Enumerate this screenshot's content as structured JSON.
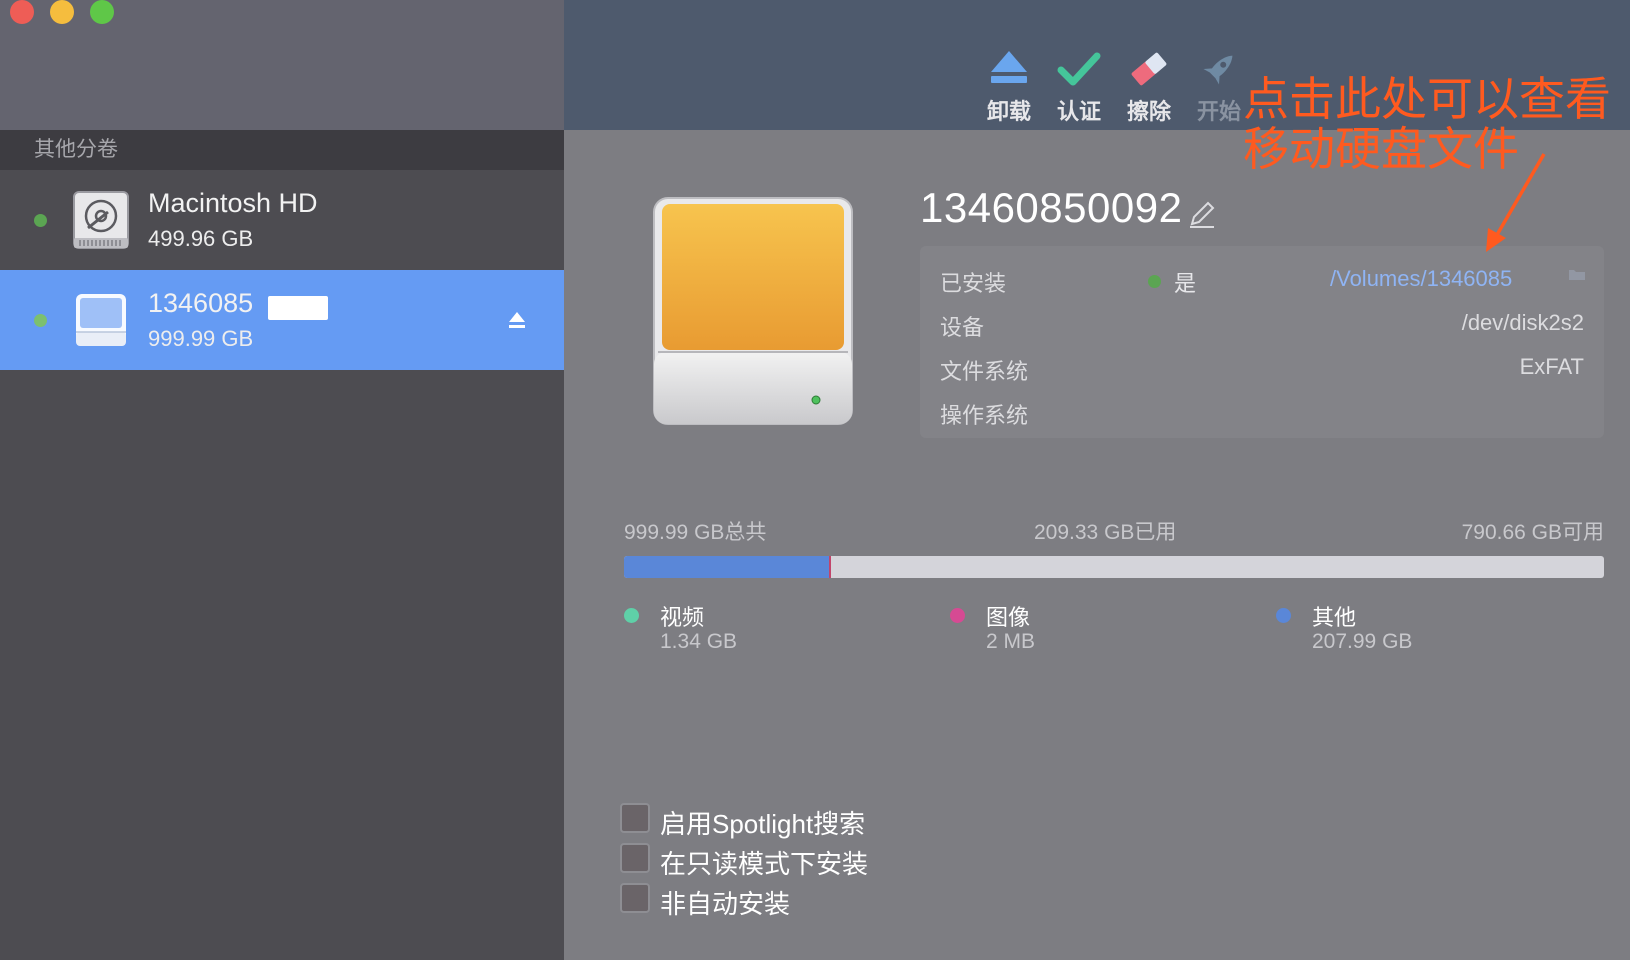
{
  "window": {
    "controls": [
      "close",
      "minimize",
      "maximize"
    ]
  },
  "sidebar": {
    "section_title": "其他分卷",
    "volumes": [
      {
        "name": "Macintosh HD",
        "size": "499.96 GB",
        "selected": false,
        "icon": "internal-disk-icon"
      },
      {
        "name": "1346085",
        "size": "999.99 GB",
        "selected": true,
        "icon": "external-disk-icon",
        "eject": "eject-icon"
      }
    ]
  },
  "toolbar": {
    "unmount_label": "卸载",
    "verify_label": "认证",
    "erase_label": "擦除",
    "start_label": "开始"
  },
  "volume": {
    "name": "13460850092",
    "info": {
      "mounted_label": "已安装",
      "mounted_value": "是",
      "mount_path": "/Volumes/1346085",
      "device_label": "设备",
      "device_value": "/dev/disk2s2",
      "fs_label": "文件系统",
      "fs_value": "ExFAT",
      "os_label": "操作系统"
    },
    "usage": {
      "total": "999.99 GB总共",
      "used": "209.33 GB已用",
      "free": "790.66 GB可用",
      "used_fraction": 0.2093
    },
    "legend": [
      {
        "name": "视频",
        "size": "1.34 GB",
        "color": "#5fd0a8"
      },
      {
        "name": "图像",
        "size": "2 MB",
        "color": "#d64a93"
      },
      {
        "name": "其他",
        "size": "207.99 GB",
        "color": "#5a87d8"
      }
    ],
    "options": [
      {
        "label": "启用Spotlight搜索",
        "checked": false
      },
      {
        "label": "在只读模式下安装",
        "checked": false
      },
      {
        "label": "非自动安装",
        "checked": false
      }
    ]
  },
  "annotation": {
    "line1": "点击此处可以查看",
    "line2": "移动硬盘文件",
    "color": "#ff5a1f"
  },
  "colors": {
    "sidebar_selected": "#659bf3",
    "toolbar_bg": "#4e5a6d",
    "link": "#8fb4f4",
    "mounted_dot": "#5ba552"
  }
}
